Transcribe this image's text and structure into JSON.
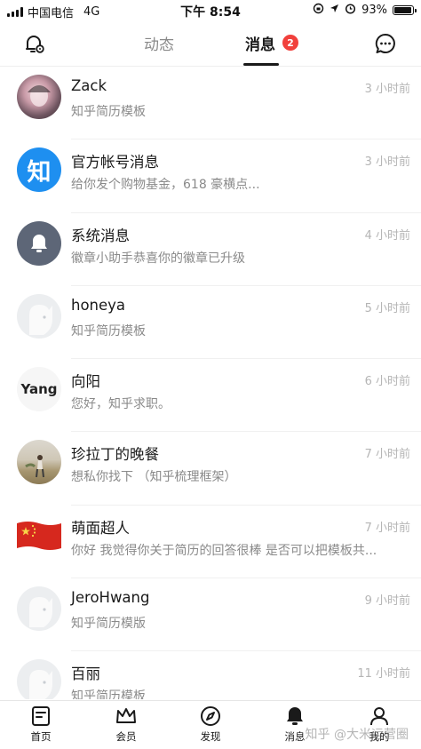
{
  "status_bar": {
    "carrier": "中国电信",
    "network": "4G",
    "time": "下午 8:54",
    "battery": "93%",
    "battery_level": 0.93
  },
  "header": {
    "tabs": [
      {
        "label": "动态",
        "active": false
      },
      {
        "label": "消息",
        "active": true,
        "badge": "2"
      }
    ],
    "left_icon": "bell-settings-icon",
    "right_icon": "chat-bubble-icon"
  },
  "messages": [
    {
      "name": "Zack",
      "preview": "知乎简历模板",
      "time": "3 小时前",
      "avatar": "photo-avatar"
    },
    {
      "name": "官方帐号消息",
      "preview": "给你发个购物基金，618 豪横点...",
      "time": "3 小时前",
      "avatar": "zhihu-logo",
      "avatar_text": "知"
    },
    {
      "name": "系统消息",
      "preview": "徽章小助手恭喜你的徽章已升级",
      "time": "4 小时前",
      "avatar": "bell-icon"
    },
    {
      "name": "honeya",
      "preview": "知乎简历模板",
      "time": "5 小时前",
      "avatar": "default-avatar"
    },
    {
      "name": "向阳",
      "preview": "您好，知乎求职。",
      "time": "6 小时前",
      "avatar": "text-avatar",
      "avatar_text": "Yang"
    },
    {
      "name": "珍拉丁的晚餐",
      "preview": "想私你找下 （知乎梳理框架）",
      "time": "7 小时前",
      "avatar": "photo-avatar"
    },
    {
      "name": "萌面超人",
      "preview": "你好 我觉得你关于简历的回答很棒 是否可以把模板共...",
      "time": "7 小时前",
      "avatar": "flag-avatar"
    },
    {
      "name": "JeroHwang",
      "preview": "知乎简历模版",
      "time": "9 小时前",
      "avatar": "default-avatar"
    },
    {
      "name": "百丽",
      "preview": "知乎简历模板",
      "time": "11 小时前",
      "avatar": "default-avatar"
    }
  ],
  "tabbar": [
    {
      "label": "首页",
      "icon": "home-doc-icon"
    },
    {
      "label": "会员",
      "icon": "crown-icon"
    },
    {
      "label": "发现",
      "icon": "compass-icon"
    },
    {
      "label": "消息",
      "icon": "bell-icon"
    },
    {
      "label": "我的",
      "icon": "person-icon"
    }
  ],
  "watermark": "知乎 @大米运营圈",
  "colors": {
    "badge": "#f1403c",
    "zhihu_blue": "#1e8ff0",
    "system_gray": "#5d6677"
  }
}
